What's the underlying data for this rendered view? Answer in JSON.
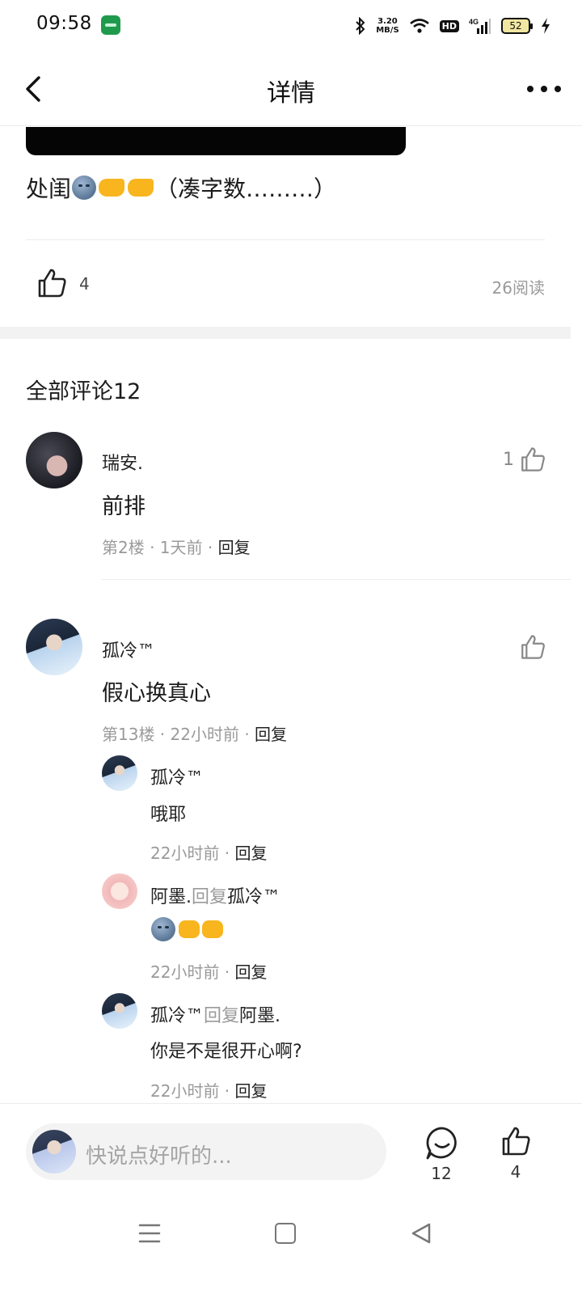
{
  "status_bar": {
    "time": "09:58",
    "network_speed_value": "3.20",
    "network_speed_unit": "MB/S",
    "hd_label": "HD",
    "signal_label": "4G",
    "battery": "52"
  },
  "header": {
    "title": "详情"
  },
  "post": {
    "text_prefix": "处闺",
    "text_suffix": "（凑字数………）",
    "like_count": "4",
    "read_count": "26阅读"
  },
  "comments_section": {
    "title": "全部评论12",
    "reply_label": "回复",
    "comments": [
      {
        "name": "瑞安.",
        "text": "前排",
        "meta": "第2楼 · 1天前 · ",
        "like_count": "1"
      },
      {
        "name": "孤冷™",
        "text": "假心换真心",
        "meta": "第13楼 · 22小时前 · ",
        "replies": [
          {
            "name": "孤冷™",
            "reply_word": "",
            "target": "",
            "text": "哦耶",
            "meta": "22小时前 · "
          },
          {
            "name": "阿墨.",
            "reply_word": "回复",
            "target": "孤冷™",
            "text": "",
            "meta": "22小时前 · "
          },
          {
            "name": "孤冷™",
            "reply_word": "回复",
            "target": "阿墨.",
            "text": "你是不是很开心啊?",
            "meta": "22小时前 · "
          }
        ]
      }
    ]
  },
  "bottom_bar": {
    "input_placeholder": "快说点好听的...",
    "comment_count": "12",
    "like_count": "4"
  },
  "icons": {
    "back": "chevron-left-icon",
    "more": "more-dots-icon",
    "like": "thumbs-up-icon",
    "comment": "comment-bubble-icon"
  }
}
